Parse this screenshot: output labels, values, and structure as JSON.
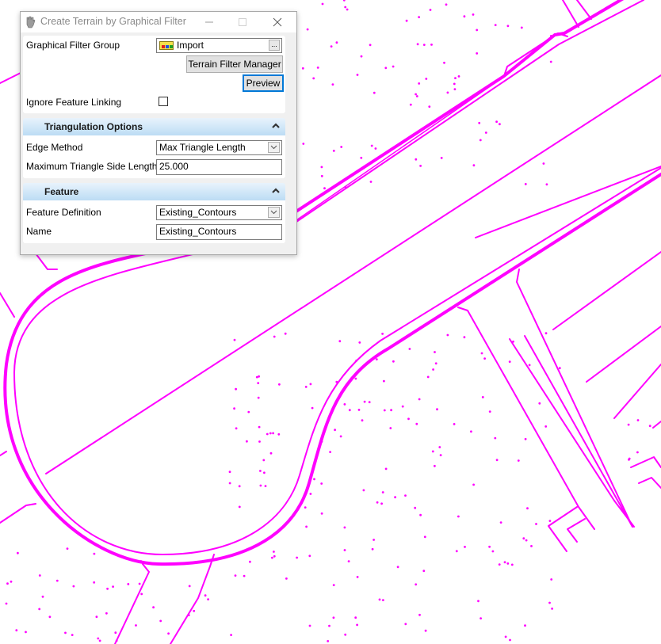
{
  "window": {
    "title": "Create Terrain by Graphical Filter",
    "icon": "hand-icon",
    "controls": {
      "minimize": "minimize-icon",
      "maximize": "maximize-icon",
      "close": "close-icon"
    }
  },
  "general": {
    "graphical_filter_group_label": "Graphical Filter Group",
    "graphical_filter_group_value": "Import",
    "graphical_filter_group_icon": "filter-group-icon",
    "browse_button_label": "...",
    "terrain_filter_manager_label": "Terrain Filter Manager",
    "preview_label": "Preview",
    "ignore_feature_linking_label": "Ignore Feature Linking",
    "ignore_feature_linking_checked": false
  },
  "triangulation_options": {
    "header": "Triangulation Options",
    "expanded": true,
    "edge_method_label": "Edge Method",
    "edge_method_value": "Max Triangle Length",
    "max_side_length_label": "Maximum Triangle Side Length",
    "max_side_length_value": "25.000"
  },
  "feature": {
    "header": "Feature",
    "expanded": true,
    "feature_definition_label": "Feature Definition",
    "feature_definition_value": "Existing_Contours",
    "name_label": "Name",
    "name_value": "Existing_Contours"
  },
  "colors": {
    "cad_linework": "#ff00ff",
    "canvas_background": "#ffffff",
    "focus_border": "#0078d7",
    "section_header_top": "#e8f3fc",
    "section_header_bottom": "#bcdcf4"
  }
}
